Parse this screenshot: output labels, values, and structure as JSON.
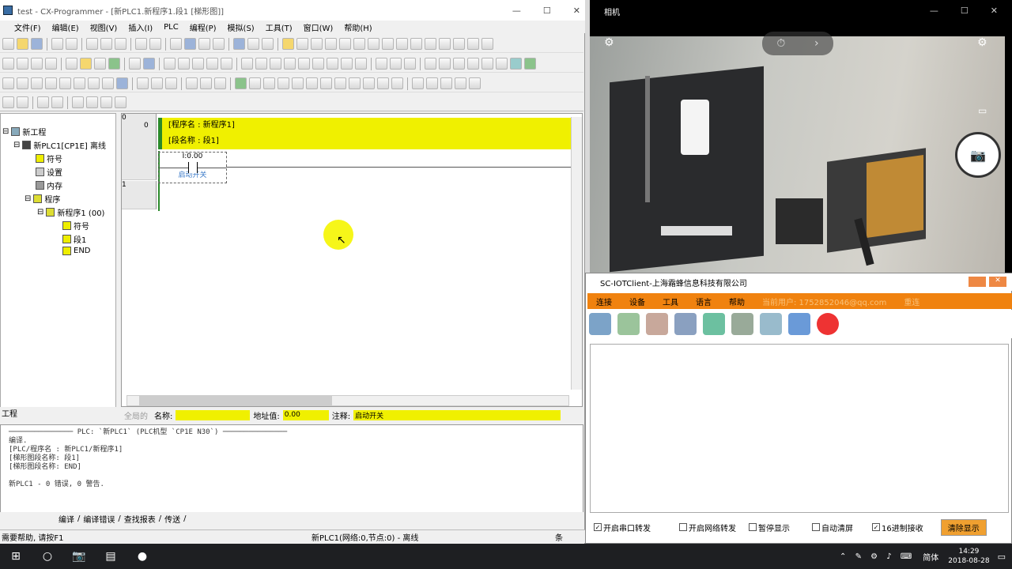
{
  "cx": {
    "title": "test - CX-Programmer - [新PLC1.新程序1.段1 [梯形图]]",
    "menu": [
      "文件(F)",
      "编辑(E)",
      "视图(V)",
      "插入(I)",
      "PLC",
      "编程(P)",
      "模拟(S)",
      "工具(T)",
      "窗口(W)",
      "帮助(H)"
    ],
    "tree": {
      "project": "新工程",
      "plc": "新PLC1[CP1E] 离线",
      "symbols": "符号",
      "settings": "设置",
      "memory": "内存",
      "programs": "程序",
      "program1": "新程序1 (00)",
      "p_symbols": "符号",
      "section1": "段1",
      "end": "END"
    },
    "tree_tab": "工程",
    "ladder": {
      "row0": "0",
      "row0b": "0",
      "row1": "1",
      "prog_name": "[程序名 : 新程序1]",
      "sec_name": "[段名称 : 段1]",
      "contact_addr": "I:0.00",
      "contact_comment": "启动开关"
    },
    "props": {
      "global": "全局的",
      "name_label": "名称:",
      "addr_label": "地址值:",
      "addr_value": "0.00",
      "comment_label": "注释:",
      "comment_value": "启动开关"
    },
    "output_lines": [
      "─────────────── PLC: `新PLC1` (PLC机型 `CP1E N30`) ───────────────",
      "编译.",
      "[PLC/程序名 : 新PLC1/新程序1]",
      "[梯形图段名称: 段1]",
      "[梯形图段名称: END]",
      "",
      "新PLC1 - 0 错误, 0 警告."
    ],
    "output_tabs": [
      "编译",
      "编译错误",
      "查找报表",
      "传送"
    ],
    "status_left": "需要帮助, 请按F1",
    "status_mid": "新PLC1(网络:0,节点:0) - 离线",
    "status_right": "条"
  },
  "camera": {
    "title": "相机",
    "timer_icon": "⏱",
    "chevron": "›"
  },
  "iot": {
    "title": "SC-IOTClient-上海霜蜂信息科技有限公司",
    "menu": [
      "连接",
      "设备",
      "工具",
      "语言",
      "帮助",
      "当前用户: 1752852046@qq.com",
      "重连"
    ],
    "checkboxes": [
      {
        "label": "开启串口转发",
        "checked": true
      },
      {
        "label": "开启网络转发",
        "checked": false
      },
      {
        "label": "暂停显示",
        "checked": false
      },
      {
        "label": "自动清屏",
        "checked": false
      },
      {
        "label": "16进制接收",
        "checked": true
      }
    ],
    "clear_label": "清除显示"
  },
  "taskbar": {
    "time": "14:29",
    "date": "2018-08-28",
    "lang": "简体"
  }
}
